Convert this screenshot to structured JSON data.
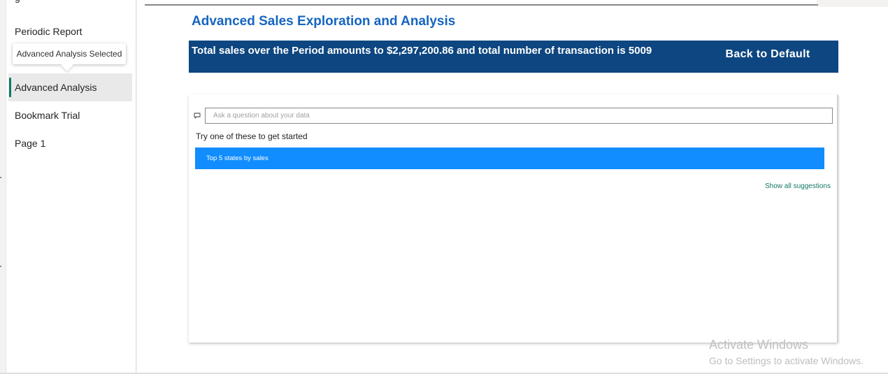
{
  "sidebar": {
    "items": [
      {
        "label": "Periodic Report"
      },
      {
        "label": "Advanced Analysis",
        "active": true
      },
      {
        "label": "Bookmark Trial"
      },
      {
        "label": "Page 1"
      }
    ],
    "tooltip": "Advanced Analysis Selected"
  },
  "report": {
    "title": "Advanced Sales Exploration and Analysis",
    "banner_text": "Total sales over the Period amounts to $2,297,200.86 and total number of transaction is 5009",
    "back_button": "Back to Default",
    "qa": {
      "placeholder": "Ask a question about your data",
      "hint": "Try one of these to get started",
      "suggestions": [
        "Top 5 states by sales"
      ],
      "show_all": "Show all suggestions"
    }
  },
  "watermark": {
    "line1": "Activate Windows",
    "line2": "Go to Settings to activate Windows."
  },
  "colors": {
    "title": "#1565c0",
    "banner": "#0d4680",
    "suggestion": "#118dff",
    "accent": "#117865"
  },
  "icons": [
    "comment-icon"
  ]
}
